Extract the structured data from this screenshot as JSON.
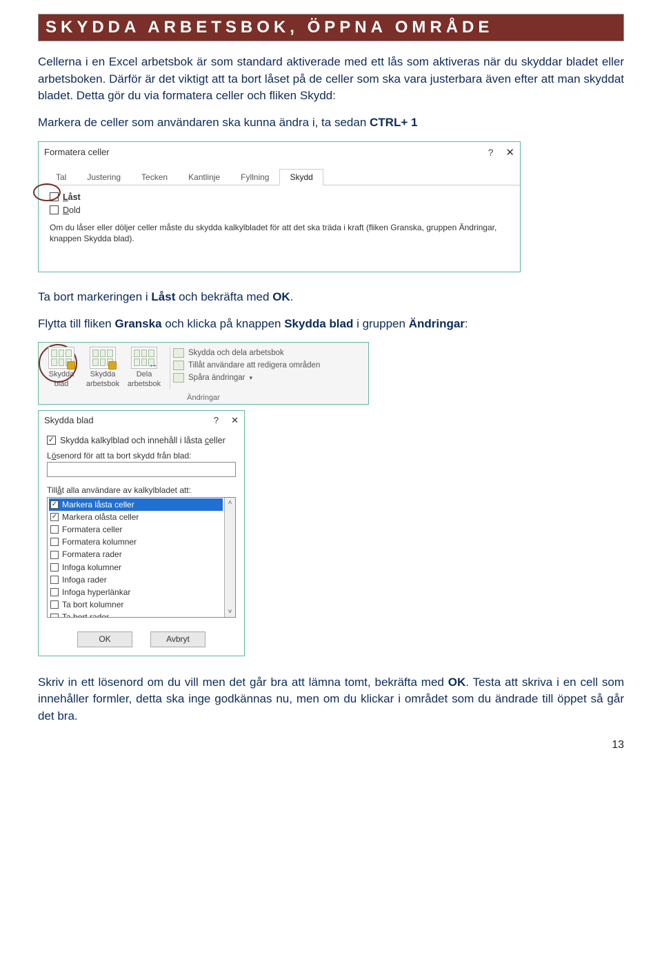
{
  "heading": "SKYDDA ARBETSBOK, ÖPPNA OMRÅDE",
  "paragraphs": {
    "p1": "Cellerna i en Excel arbetsbok är som standard aktiverade med ett lås som aktiveras när du skyddar bladet eller arbetsboken. Därför är det viktigt att ta bort låset på de celler som ska vara justerbara även efter att man skyddat bladet. Detta gör du via formatera celler och fliken Skydd:",
    "p2_pre": "Markera de celler som användaren ska kunna ändra i, ta sedan ",
    "p2_bold": "CTRL+ 1",
    "p3_pre": "Ta bort markeringen i ",
    "p3_b1": "Låst",
    "p3_mid": " och bekräfta med ",
    "p3_b2": "OK",
    "p3_end": ".",
    "p4_pre": "Flytta till fliken ",
    "p4_b1": "Granska",
    "p4_mid": " och klicka på knappen ",
    "p4_b2": "Skydda blad",
    "p4_mid2": " i gruppen ",
    "p4_b3": "Ändringar",
    "p4_end": ":",
    "p5_pre": "Skriv in ett lösenord om du vill men det går bra att lämna tomt, bekräfta med ",
    "p5_b1": "OK",
    "p5_end": ". Testa att skriva i en cell som innehåller formler, detta ska inge godkännas nu, men om du klickar i området som du ändrade till öppet så går det bra."
  },
  "formatcells": {
    "title": "Formatera celler",
    "tabs": [
      "Tal",
      "Justering",
      "Tecken",
      "Kantlinje",
      "Fyllning",
      "Skydd"
    ],
    "active_tab": 5,
    "opt_locked": "Låst",
    "opt_locked_prefix": "L",
    "opt_hidden": "old",
    "opt_hidden_prefix": "D",
    "info": "Om du låser eller döljer celler måste du skydda kalkylbladet för att det ska träda i kraft (fliken Granska, gruppen Ändringar, knappen Skydda blad)."
  },
  "ribbon": {
    "buttons": [
      {
        "label1": "Skydda",
        "label2": "blad"
      },
      {
        "label1": "Skydda",
        "label2": "arbetsbok"
      },
      {
        "label1": "Dela",
        "label2": "arbetsbok"
      }
    ],
    "right_items": [
      "Skydda och dela arbetsbok",
      "Tillåt användare att redigera områden",
      "Spåra ändringar"
    ],
    "group_label": "Ändringar"
  },
  "protect": {
    "title": "Skydda blad",
    "main_chk_pre": "Skydda kalkylblad och innehåll i låsta ",
    "main_chk_u": "c",
    "main_chk_post": "eller",
    "pw_label_pre": "L",
    "pw_label_u": "ö",
    "pw_label_post": "senord för att ta bort skydd från blad:",
    "perm_label_pre": "Till",
    "perm_label_u": "å",
    "perm_label_post": "t alla användare av kalkylbladet att:",
    "perms": [
      {
        "checked": true,
        "selected": true,
        "label": "Markera låsta celler"
      },
      {
        "checked": true,
        "selected": false,
        "label": "Markera olåsta celler"
      },
      {
        "checked": false,
        "selected": false,
        "label": "Formatera celler"
      },
      {
        "checked": false,
        "selected": false,
        "label": "Formatera kolumner"
      },
      {
        "checked": false,
        "selected": false,
        "label": "Formatera rader"
      },
      {
        "checked": false,
        "selected": false,
        "label": "Infoga kolumner"
      },
      {
        "checked": false,
        "selected": false,
        "label": "Infoga rader"
      },
      {
        "checked": false,
        "selected": false,
        "label": "Infoga hyperlänkar"
      },
      {
        "checked": false,
        "selected": false,
        "label": "Ta bort kolumner"
      },
      {
        "checked": false,
        "selected": false,
        "label": "Ta bort rader"
      }
    ],
    "ok": "OK",
    "cancel": "Avbryt"
  },
  "page_number": "13"
}
